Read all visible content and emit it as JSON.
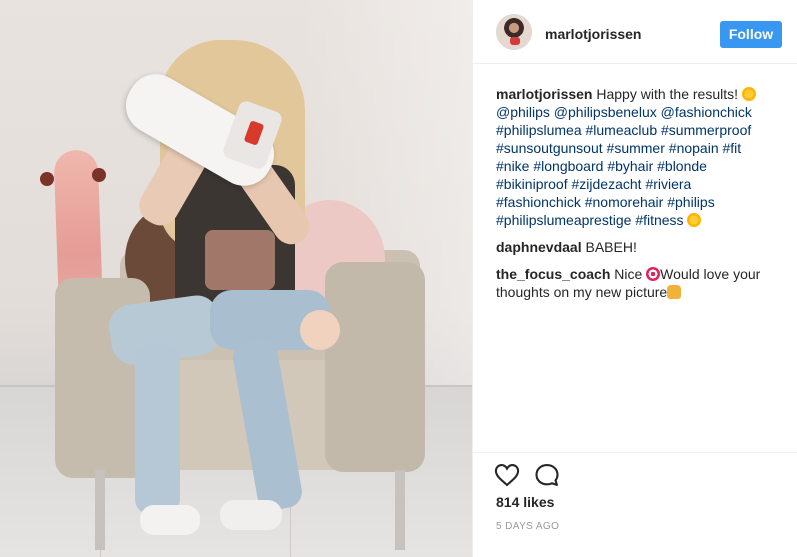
{
  "header": {
    "username": "marlotjorissen",
    "follow_label": "Follow"
  },
  "caption": {
    "username": "marlotjorissen",
    "text": "Happy with the results!",
    "mentions": [
      "@philips",
      "@philipsbenelux",
      "@fashionchick"
    ],
    "hashtags": [
      "#philipslumea",
      "#lumeaclub",
      "#summerproof",
      "#sunsoutgunsout",
      "#summer",
      "#nopain",
      "#fit",
      "#nike",
      "#longboard",
      "#byhair",
      "#blonde",
      "#bikiniproof",
      "#zijdezacht",
      "#riviera",
      "#fashionchick",
      "#nomorehair",
      "#philips",
      "#philipslumeaprestige",
      "#fitness"
    ]
  },
  "comments": [
    {
      "username": "daphnevdaal",
      "text": "BABEH!"
    },
    {
      "username": "the_focus_coach",
      "text_before": "Nice",
      "text_after": "Would love your thoughts on my new picture"
    }
  ],
  "stats": {
    "likes": "814 likes",
    "time_ago": "5 DAYS AGO"
  },
  "icons": {
    "like": "heart-icon",
    "comment": "comment-bubble-icon"
  },
  "colors": {
    "follow_button": "#3897f0",
    "hashtag": "#003569",
    "meta_text": "#999999"
  }
}
